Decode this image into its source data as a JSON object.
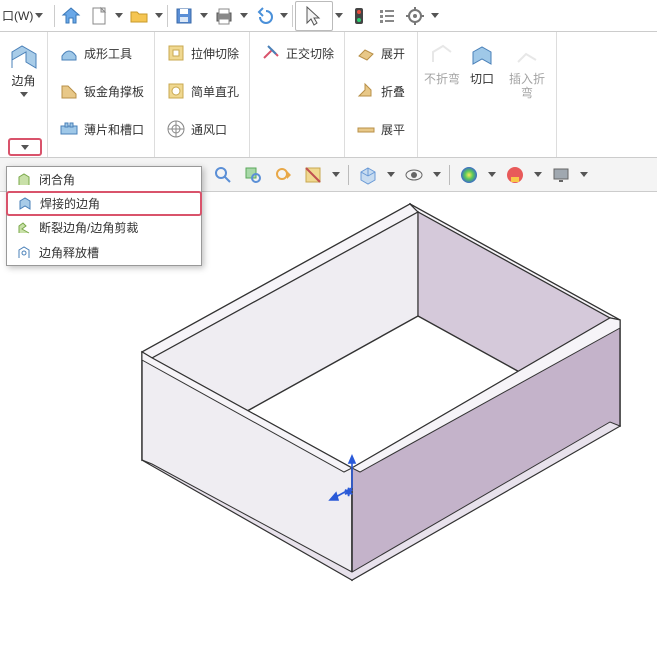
{
  "topbar": {
    "window_menu": "口(W)",
    "tooltips": {
      "home": "主页",
      "new": "新建",
      "open": "打开",
      "save": "保存",
      "print": "打印",
      "undo": "撤销",
      "select": "选择",
      "rebuild": "重建",
      "options_list": "文件列表",
      "settings": "设置"
    }
  },
  "ribbon": {
    "corner_label": "边角",
    "col2": {
      "forming_tool": "成形工具",
      "gusset": "钣金角撑板",
      "tab_slot": "薄片和槽口"
    },
    "col3": {
      "extrude_cut": "拉伸切除",
      "simple_hole": "简单直孔",
      "vent": "通风口"
    },
    "col4": {
      "normal_cut": "正交切除"
    },
    "col5": {
      "unfold": "展开",
      "fold": "折叠",
      "flatten": "展平"
    },
    "right": {
      "no_bend": "不折弯",
      "cut": "切口",
      "insert_bend": "插入折弯"
    }
  },
  "menu": {
    "closed_corner": "闭合角",
    "welded_corner": "焊接的边角",
    "break_corner": "断裂边角/边角剪裁",
    "corner_relief": "边角释放槽"
  },
  "statusbar": {},
  "colors": {
    "highlight": "#d9536b",
    "face_light": "#d5c9da",
    "face_dark": "#b9a9c0"
  }
}
